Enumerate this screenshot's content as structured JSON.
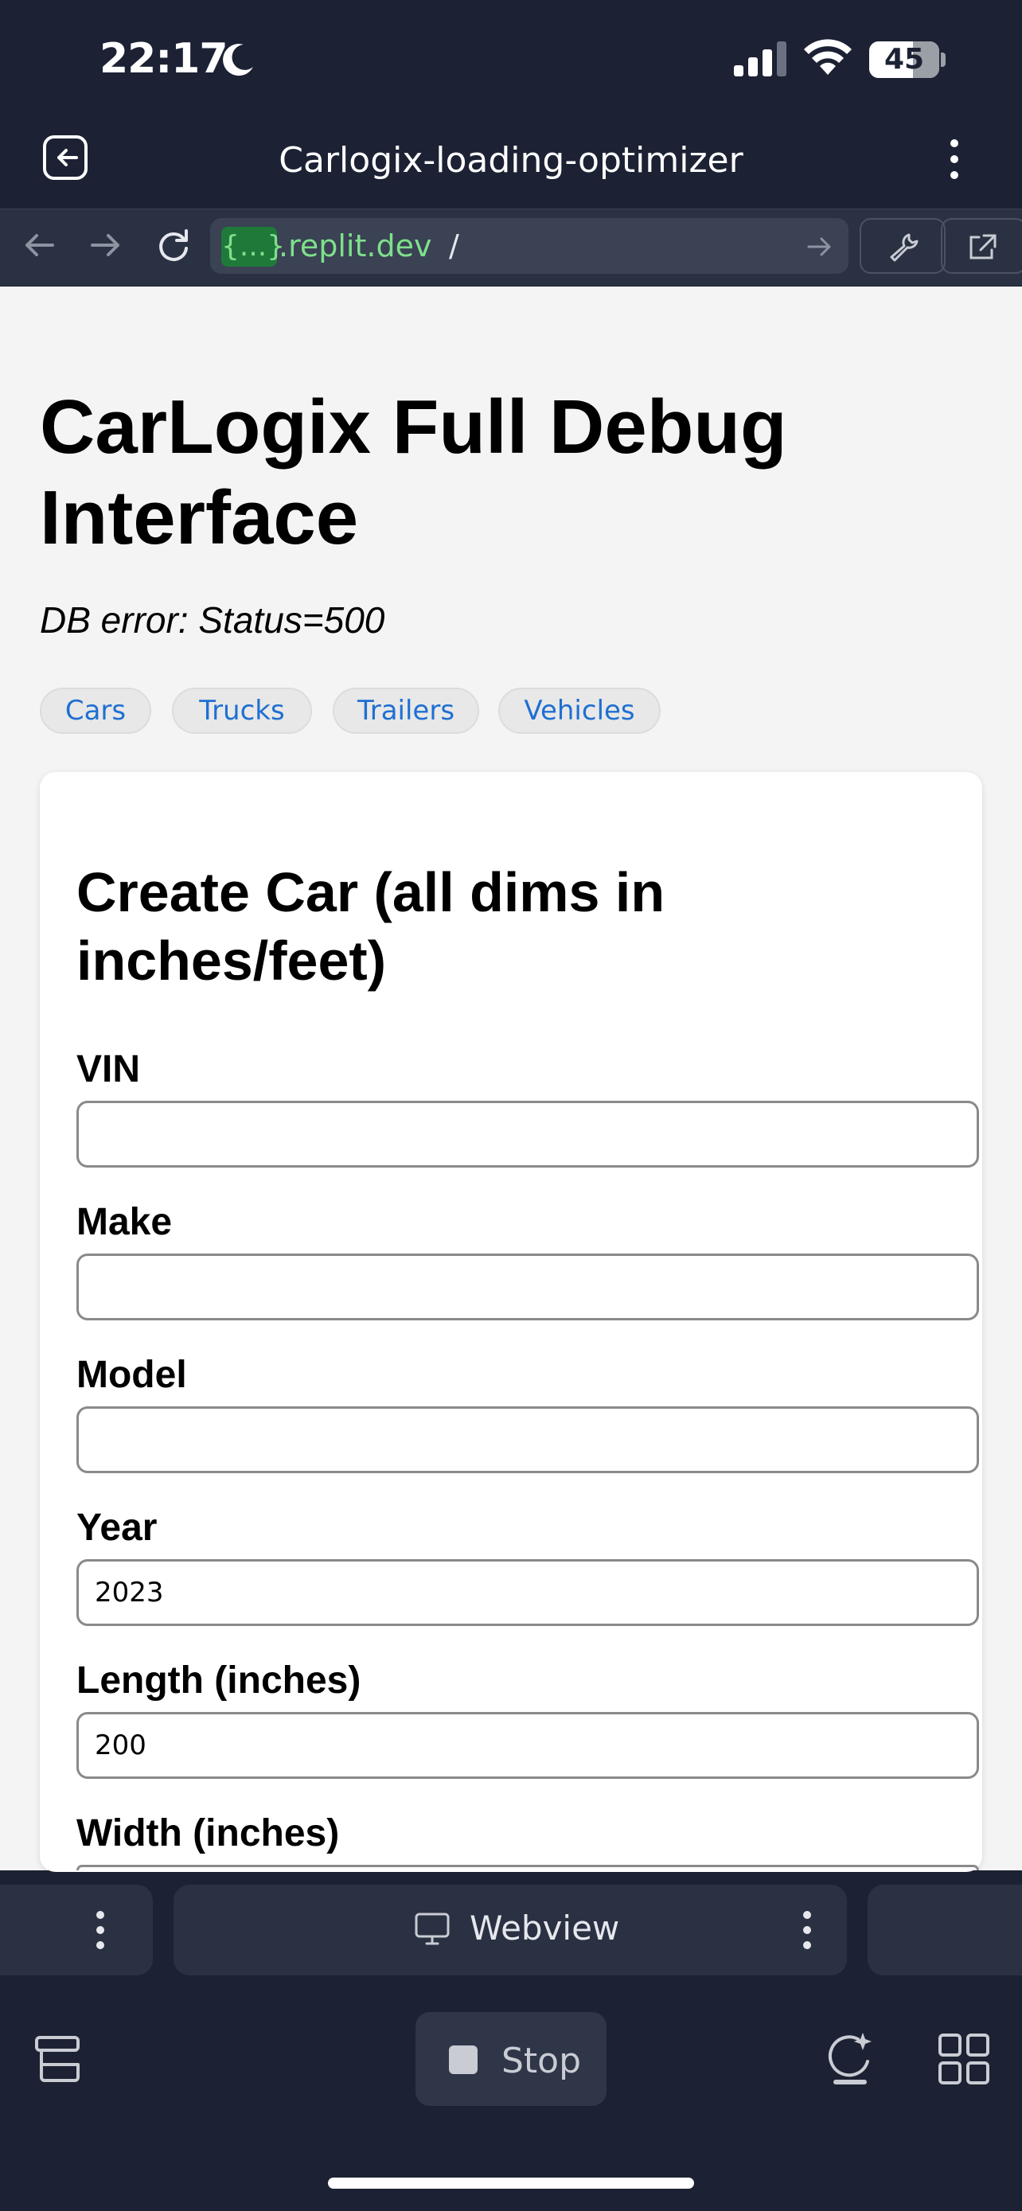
{
  "status_bar": {
    "time": "22:17",
    "battery": "45",
    "icons": [
      "moon-icon",
      "cellular-signal-icon",
      "wifi-icon",
      "battery-icon"
    ]
  },
  "app_header": {
    "title": "Carlogix-loading-optimizer",
    "icons": [
      "exit-icon",
      "more-vertical-icon"
    ]
  },
  "browser_bar": {
    "url_badge": "{...}",
    "url_host": ".replit.dev",
    "url_path": "/",
    "icons": [
      "back-arrow-icon",
      "forward-arrow-icon",
      "reload-icon",
      "go-arrow-icon",
      "wrench-icon",
      "open-external-icon"
    ]
  },
  "page": {
    "title": "CarLogix Full Debug Interface",
    "error": "DB error: Status=500",
    "tabs": [
      "Cars",
      "Trucks",
      "Trailers",
      "Vehicles"
    ],
    "form": {
      "heading": "Create Car (all dims in inches/feet)",
      "fields": [
        {
          "label": "VIN",
          "value": ""
        },
        {
          "label": "Make",
          "value": ""
        },
        {
          "label": "Model",
          "value": ""
        },
        {
          "label": "Year",
          "value": "2023"
        },
        {
          "label": "Length (inches)",
          "value": "200"
        },
        {
          "label": "Width (inches)",
          "value": ""
        }
      ]
    }
  },
  "tab_strip": {
    "active_tab": "Webview",
    "icons": [
      "monitor-icon",
      "more-vertical-icon"
    ]
  },
  "bottom_bar": {
    "stop_label": "Stop",
    "icons": [
      "layers-icon",
      "stop-icon",
      "assistant-icon",
      "grid-icon"
    ]
  },
  "colors": {
    "chrome_background": "#1c2233",
    "browser_bar": "#2a3142",
    "url_green": "#7ee08a",
    "link_blue": "#1f6fd1",
    "page_background": "#f4f4f4"
  }
}
